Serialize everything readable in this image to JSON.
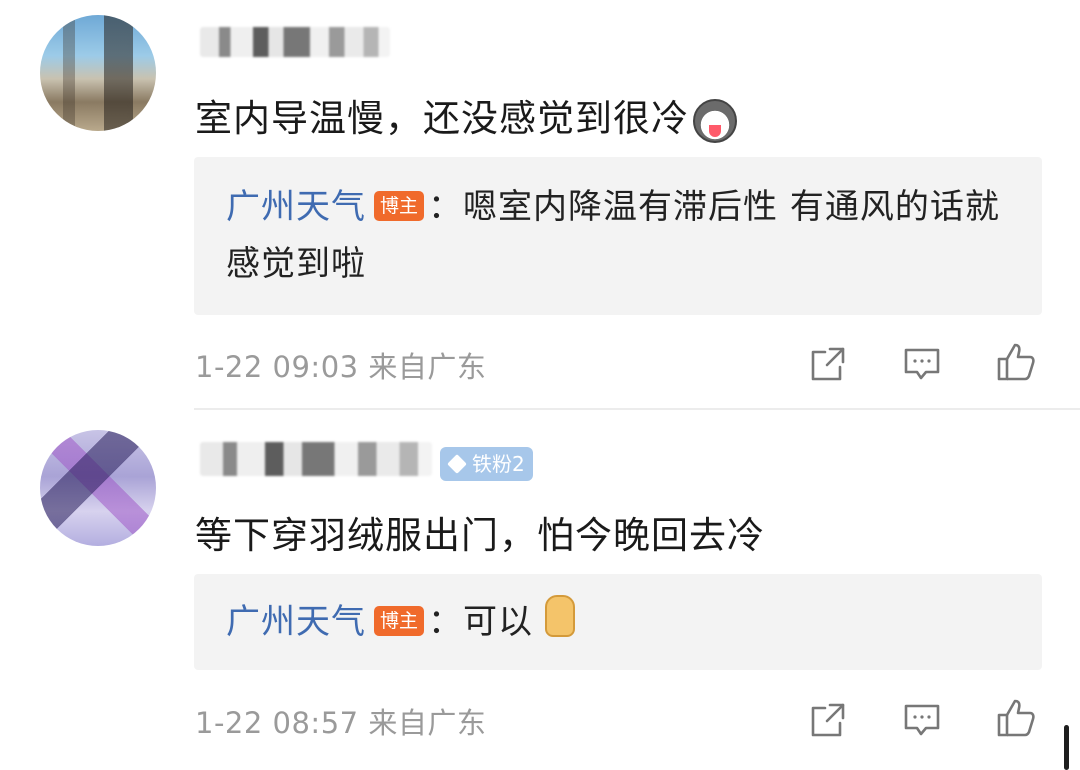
{
  "comments": [
    {
      "text": "室内导温慢，还没感觉到很冷",
      "emoji": "husky-face-icon",
      "reply": {
        "author": "广州天气",
        "badge": "博主",
        "separator": "：",
        "text": "嗯室内降温有滞后性 有通风的话就感觉到啦"
      },
      "time": "1-22 09:03",
      "location": "来自广东"
    },
    {
      "text": "等下穿羽绒服出门，怕今晚回去冷",
      "fan_badge": "铁粉2",
      "reply": {
        "author": "广州天气",
        "badge": "博主",
        "separator": "：",
        "text": "可以",
        "emoji": "thumbs-up-icon"
      },
      "time": "1-22 08:57",
      "location": "来自广东"
    }
  ],
  "actions": [
    "share-icon",
    "comment-icon",
    "like-icon"
  ],
  "colors": {
    "author": "#3f6bb1",
    "blogger_badge": "#f06a2b",
    "fan_badge": "#a7c7ea",
    "meta": "#9a9a9a",
    "reply_bg": "#f3f3f3"
  }
}
